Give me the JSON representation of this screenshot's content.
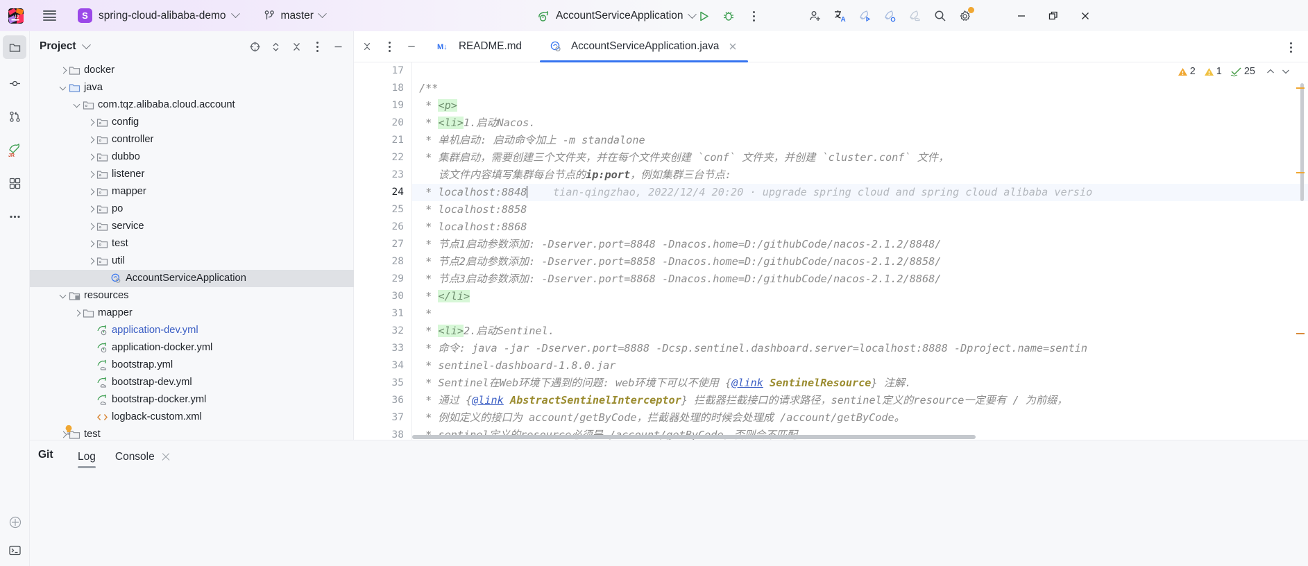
{
  "titlebar": {
    "app_logo_icon": "intellij-idea-logo",
    "menu_icon": "hamburger-menu-icon",
    "project_badge": "S",
    "project_name": "spring-cloud-alibaba-demo",
    "project_chevron_icon": "chevron-down-icon",
    "branch_icon": "git-branch-icon",
    "branch_name": "master",
    "branch_chevron_icon": "chevron-down-icon",
    "run_config_icon": "spring-boot-icon",
    "run_config_name": "AccountServiceApplication",
    "run_config_chevron_icon": "chevron-down-icon",
    "run_icon": "run-play-icon",
    "debug_icon": "debug-bug-icon",
    "more_icon": "more-vertical-icon",
    "actions": [
      {
        "icon": "add-user-icon"
      },
      {
        "icon": "translate-icon"
      },
      {
        "icon": "rocket-run-icon"
      },
      {
        "icon": "rocket-zero-icon"
      },
      {
        "icon": "rocket-cloud-icon"
      },
      {
        "icon": "search-icon"
      },
      {
        "icon": "settings-gear-icon",
        "badge": true
      }
    ],
    "window_controls": [
      {
        "icon": "minimize-window-icon"
      },
      {
        "icon": "restore-window-icon"
      },
      {
        "icon": "close-window-icon"
      }
    ]
  },
  "rail": {
    "items": [
      {
        "icon": "project-folder-icon",
        "active": true
      },
      {
        "icon": "commit-icon",
        "active": false
      },
      {
        "icon": "pull-request-icon",
        "active": false
      },
      {
        "icon": "jrebel-icon",
        "active": false
      },
      {
        "icon": "structure-icon",
        "active": false
      },
      {
        "icon": "more-dots-icon",
        "active": false
      }
    ],
    "bottom": [
      {
        "icon": "settings-circle-icon"
      },
      {
        "icon": "terminal-icon"
      }
    ]
  },
  "project_panel": {
    "title": "Project",
    "title_chevron_icon": "chevron-down-icon",
    "actions": [
      {
        "icon": "scroll-from-source-icon"
      },
      {
        "icon": "expand-collapse-icon"
      },
      {
        "icon": "collapse-all-icon"
      },
      {
        "icon": "more-vertical-icon"
      },
      {
        "icon": "hide-panel-icon"
      }
    ],
    "tree": [
      {
        "label": "docker",
        "indent": 2,
        "arrow": "right",
        "icon": "folder-icon",
        "selected": false,
        "color": "default"
      },
      {
        "label": "java",
        "indent": 2,
        "arrow": "down",
        "icon": "folder-source-icon",
        "selected": false,
        "color": "default"
      },
      {
        "label": "com.tqz.alibaba.cloud.account",
        "indent": 3,
        "arrow": "down",
        "icon": "package-icon",
        "selected": false,
        "color": "default"
      },
      {
        "label": "config",
        "indent": 4,
        "arrow": "right",
        "icon": "package-icon",
        "selected": false,
        "color": "default"
      },
      {
        "label": "controller",
        "indent": 4,
        "arrow": "right",
        "icon": "package-icon",
        "selected": false,
        "color": "default"
      },
      {
        "label": "dubbo",
        "indent": 4,
        "arrow": "right",
        "icon": "package-icon",
        "selected": false,
        "color": "default"
      },
      {
        "label": "listener",
        "indent": 4,
        "arrow": "right",
        "icon": "package-icon",
        "selected": false,
        "color": "default"
      },
      {
        "label": "mapper",
        "indent": 4,
        "arrow": "right",
        "icon": "package-icon",
        "selected": false,
        "color": "default"
      },
      {
        "label": "po",
        "indent": 4,
        "arrow": "right",
        "icon": "package-icon",
        "selected": false,
        "color": "default"
      },
      {
        "label": "service",
        "indent": 4,
        "arrow": "right",
        "icon": "package-icon",
        "selected": false,
        "color": "default"
      },
      {
        "label": "test",
        "indent": 4,
        "arrow": "right",
        "icon": "package-icon",
        "selected": false,
        "color": "default"
      },
      {
        "label": "util",
        "indent": 4,
        "arrow": "right",
        "icon": "package-icon",
        "selected": false,
        "color": "default"
      },
      {
        "label": "AccountServiceApplication",
        "indent": 5,
        "arrow": "none",
        "icon": "spring-class-icon",
        "selected": true,
        "color": "default"
      },
      {
        "label": "resources",
        "indent": 2,
        "arrow": "down",
        "icon": "resources-folder-icon",
        "selected": false,
        "color": "default"
      },
      {
        "label": "mapper",
        "indent": 3,
        "arrow": "right",
        "icon": "folder-icon",
        "selected": false,
        "color": "default"
      },
      {
        "label": "application-dev.yml",
        "indent": 4,
        "arrow": "none",
        "icon": "spring-yaml-icon",
        "selected": false,
        "color": "blue"
      },
      {
        "label": "application-docker.yml",
        "indent": 4,
        "arrow": "none",
        "icon": "spring-yaml-icon",
        "selected": false,
        "color": "default"
      },
      {
        "label": "bootstrap.yml",
        "indent": 4,
        "arrow": "none",
        "icon": "spring-cloud-yaml-icon",
        "selected": false,
        "color": "default"
      },
      {
        "label": "bootstrap-dev.yml",
        "indent": 4,
        "arrow": "none",
        "icon": "spring-cloud-yaml-icon",
        "selected": false,
        "color": "default"
      },
      {
        "label": "bootstrap-docker.yml",
        "indent": 4,
        "arrow": "none",
        "icon": "spring-cloud-yaml-icon",
        "selected": false,
        "color": "default"
      },
      {
        "label": "logback-custom.xml",
        "indent": 4,
        "arrow": "none",
        "icon": "xml-file-icon",
        "selected": false,
        "color": "default"
      },
      {
        "label": "test",
        "indent": 2,
        "arrow": "right",
        "icon": "folder-icon",
        "selected": false,
        "color": "default"
      }
    ]
  },
  "editor": {
    "tab_controls": [
      {
        "icon": "collapse-all-icon"
      },
      {
        "icon": "more-vertical-icon"
      },
      {
        "icon": "hide-panel-icon"
      }
    ],
    "tabs": [
      {
        "label": "README.md",
        "icon": "markdown-icon",
        "active": false,
        "closable": false
      },
      {
        "label": "AccountServiceApplication.java",
        "icon": "spring-class-icon",
        "active": true,
        "closable": true
      }
    ],
    "tabbar_more_icon": "more-vertical-icon",
    "inspections": {
      "warning_icon": "warning-triangle-icon",
      "warning_count": "2",
      "weak_warning_icon": "weak-warning-triangle-icon",
      "weak_warning_count": "1",
      "typo_icon": "typo-check-icon",
      "typo_count": "25",
      "prev_icon": "chevron-up-icon",
      "next_icon": "chevron-down-icon"
    },
    "first_line_number": 17,
    "current_line": 24,
    "blame": "tian-qingzhao, 2022/12/4 20:20 · upgrade spring cloud and spring cloud alibaba versio",
    "lines": [
      {
        "n": 17,
        "text": ""
      },
      {
        "n": 18,
        "text": "/**"
      },
      {
        "n": 19,
        "text": " * <p>"
      },
      {
        "n": 20,
        "text": " * <li>1.启动Nacos."
      },
      {
        "n": 21,
        "text": " * 单机启动: 启动命令加上 -m standalone"
      },
      {
        "n": 22,
        "text": " * 集群启动，需要创建三个文件夹，并在每个文件夹创建 `conf` 文件夹，并创建 `cluster.conf` 文件，"
      },
      {
        "n": 23,
        "text": " * 该文件内容填写集群每台节点的ip:port，例如集群三台节点:"
      },
      {
        "n": 24,
        "text": " * localhost:8848"
      },
      {
        "n": 25,
        "text": " * localhost:8858"
      },
      {
        "n": 26,
        "text": " * localhost:8868"
      },
      {
        "n": 27,
        "text": " * 节点1启动参数添加: -Dserver.port=8848 -Dnacos.home=D:/githubCode/nacos-2.1.2/8848/"
      },
      {
        "n": 28,
        "text": " * 节点2启动参数添加: -Dserver.port=8858 -Dnacos.home=D:/githubCode/nacos-2.1.2/8858/"
      },
      {
        "n": 29,
        "text": " * 节点3启动参数添加: -Dserver.port=8868 -Dnacos.home=D:/githubCode/nacos-2.1.2/8868/"
      },
      {
        "n": 30,
        "text": " * </li>"
      },
      {
        "n": 31,
        "text": " *"
      },
      {
        "n": 32,
        "text": " * <li>2.启动Sentinel."
      },
      {
        "n": 33,
        "text": " * 命令: java -jar -Dserver.port=8888 -Dcsp.sentinel.dashboard.server=localhost:8888 -Dproject.name=sentin"
      },
      {
        "n": 34,
        "text": " * sentinel-dashboard-1.8.0.jar"
      },
      {
        "n": 35,
        "text": " * Sentinel在Web环境下遇到的问题: web环境下可以不使用 {@link SentinelResource} 注解."
      },
      {
        "n": 36,
        "text": " * 通过 {@link AbstractSentinelInterceptor} 拦截器拦截接口的请求路径，sentinel定义的resource一定要有 / 为前缀，"
      },
      {
        "n": 37,
        "text": " * 例如定义的接口为 account/getByCode，拦截器处理的时候会处理成 /account/getByCode。"
      },
      {
        "n": 38,
        "text": " * sentinel定义的resource必须是 /account/getByCode，否则会不匹配。"
      }
    ]
  },
  "bottom_panel": {
    "git_label": "Git",
    "tabs": [
      {
        "label": "Log",
        "active": true,
        "closable": false
      },
      {
        "label": "Console",
        "active": false,
        "closable": true
      }
    ]
  },
  "colors": {
    "accent": "#3574f0",
    "brand_purple": "#9b48e8",
    "selection": "#dfe1e5",
    "panel_bg": "#f7f8fa",
    "tag_highlight": "#d7f7d7",
    "warning": "#f0a732",
    "link_blue": "#3b5ec4",
    "green_run": "#3a9d4e"
  }
}
